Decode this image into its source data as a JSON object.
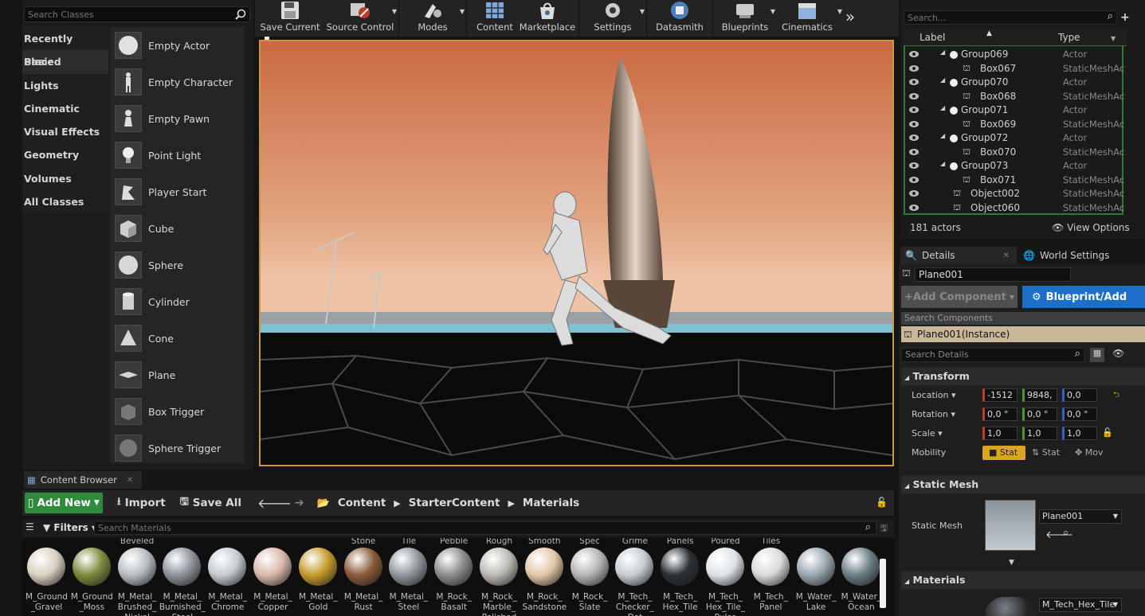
{
  "place": {
    "search_placeholder": "Search Classes",
    "categories": [
      "Recently Placed",
      "Basic",
      "Lights",
      "Cinematic",
      "Visual Effects",
      "Geometry",
      "Volumes",
      "All Classes"
    ],
    "items": [
      "Empty Actor",
      "Empty Character",
      "Empty Pawn",
      "Point Light",
      "Player Start",
      "Cube",
      "Sphere",
      "Cylinder",
      "Cone",
      "Plane",
      "Box Trigger",
      "Sphere Trigger"
    ]
  },
  "toolbar": {
    "save_current": "Save Current",
    "source_control": "Source Control",
    "modes": "Modes",
    "content": "Content",
    "marketplace": "Marketplace",
    "settings": "Settings",
    "datasmith": "Datasmith",
    "blueprints": "Blueprints",
    "cinematics": "Cinematics",
    "more": "»"
  },
  "content_browser": {
    "tab_label": "Content Browser",
    "add_new": "Add New",
    "import": "Import",
    "save_all": "Save All",
    "breadcrumb": [
      "Content",
      "StarterContent",
      "Materials"
    ],
    "filters": "Filters",
    "search_placeholder": "Search Materials",
    "top_labels": [
      "",
      "",
      "Beveled",
      "",
      "",
      "",
      "",
      "Stone",
      "Tile",
      "Pebble",
      "Rough",
      "Smooth",
      "Spec",
      "Grime",
      "Panels",
      "Poured",
      "Tiles",
      "",
      ""
    ],
    "assets": [
      {
        "label": "M_Ground _Gravel",
        "color": "#d8d0bf"
      },
      {
        "label": "M_Ground _Moss",
        "color": "#7c8a3c"
      },
      {
        "label": "M_Metal_ Brushed_ Nickel",
        "color": "#b9bdc1"
      },
      {
        "label": "M_Metal_ Burnished_ Steel",
        "color": "#8c9399"
      },
      {
        "label": "M_Metal_ Chrome",
        "color": "#c5cbd0"
      },
      {
        "label": "M_Metal_ Copper",
        "color": "#d9b9aa"
      },
      {
        "label": "M_Metal_ Gold",
        "color": "#c49a2a"
      },
      {
        "label": "M_Metal_ Rust",
        "color": "#8a5a3a"
      },
      {
        "label": "M_Metal_ Steel",
        "color": "#8f969c"
      },
      {
        "label": "M_Rock_ Basalt",
        "color": "#8c8c8c"
      },
      {
        "label": "M_Rock_ Marble_ Polished",
        "color": "#bcbab2"
      },
      {
        "label": "M_Rock_ Sandstone",
        "color": "#e2c6a8"
      },
      {
        "label": "M_Rock_ Slate",
        "color": "#b5b5b5"
      },
      {
        "label": "M_Tech_ Checker_ Dot",
        "color": "#c7ccd0"
      },
      {
        "label": "M_Tech_ Hex_Tile",
        "color": "#2a3034"
      },
      {
        "label": "M_Tech_ Hex_Tile_ Pulse",
        "color": "#dfe3e6"
      },
      {
        "label": "M_Tech_ Panel",
        "color": "#d8dadc"
      },
      {
        "label": "M_Water_ Lake",
        "color": "#9aa6b0"
      },
      {
        "label": "M_Water_ Ocean",
        "color": "#6b7d84"
      }
    ]
  },
  "outliner": {
    "search_placeholder": "Search...",
    "col_label": "Label",
    "col_type": "Type",
    "rows": [
      {
        "name": "Group069",
        "type": "Actor",
        "level": 1
      },
      {
        "name": "Box067",
        "type": "StaticMeshAc",
        "level": 2
      },
      {
        "name": "Group070",
        "type": "Actor",
        "level": 1
      },
      {
        "name": "Box068",
        "type": "StaticMeshAc",
        "level": 2
      },
      {
        "name": "Group071",
        "type": "Actor",
        "level": 1
      },
      {
        "name": "Box069",
        "type": "StaticMeshAc",
        "level": 2
      },
      {
        "name": "Group072",
        "type": "Actor",
        "level": 1
      },
      {
        "name": "Box070",
        "type": "StaticMeshAc",
        "level": 2
      },
      {
        "name": "Group073",
        "type": "Actor",
        "level": 1
      },
      {
        "name": "Box071",
        "type": "StaticMeshAc",
        "level": 2
      },
      {
        "name": "Object002",
        "type": "StaticMeshAc",
        "level": 0
      },
      {
        "name": "Object060",
        "type": "StaticMeshAc",
        "level": 0
      }
    ],
    "actor_count": "181 actors",
    "view_options": "View Options"
  },
  "details": {
    "tab_details": "Details",
    "tab_world": "World Settings",
    "object_name": "Plane001",
    "add_component": "+Add Component",
    "blueprint_add": "Blueprint/Add",
    "search_components": "Search Components",
    "instance": "Plane001(Instance)",
    "search_details": "Search Details",
    "transform_title": "Transform",
    "location_label": "Location",
    "rotation_label": "Rotation",
    "scale_label": "Scale",
    "mobility_label": "Mobility",
    "location": [
      "-1512",
      "9848,",
      "0,0"
    ],
    "rotation": [
      "0,0 °",
      "0,0 °",
      "0,0 °"
    ],
    "scale": [
      "1,0",
      "1,0",
      "1,0"
    ],
    "mobility_options": [
      "Stat",
      "Stat",
      "Mov"
    ],
    "static_mesh_title": "Static Mesh",
    "static_mesh_label": "Static Mesh",
    "static_mesh_value": "Plane001",
    "materials_title": "Materials",
    "material_value": "M_Tech_Hex_Tile"
  }
}
